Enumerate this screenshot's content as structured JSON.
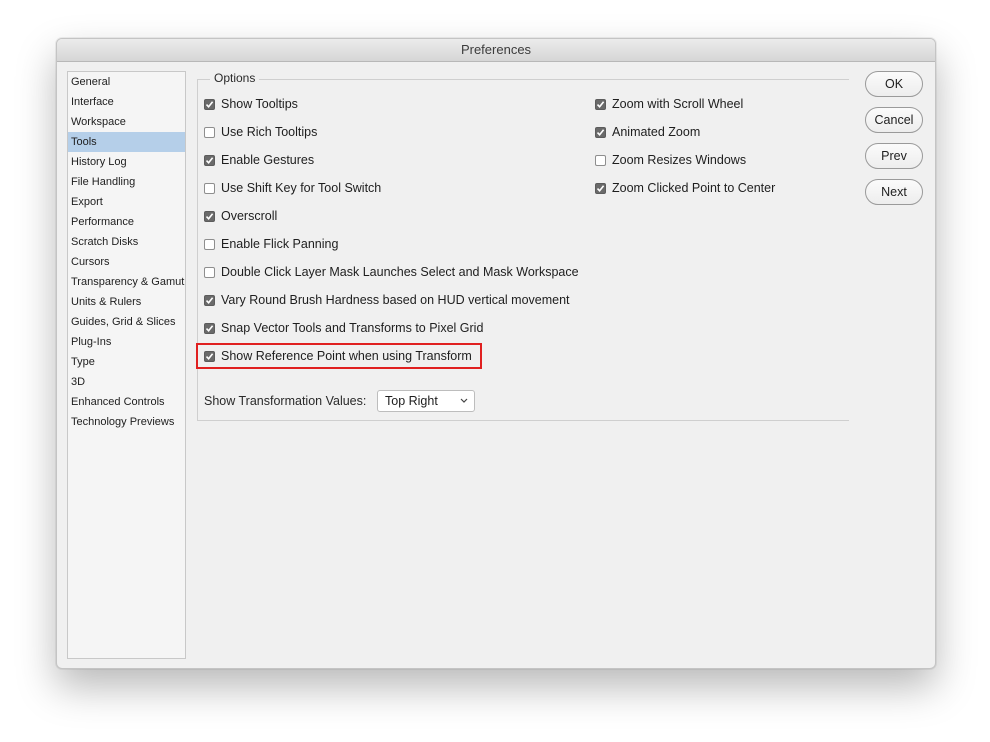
{
  "window": {
    "title": "Preferences"
  },
  "sidebar": {
    "items": [
      {
        "label": "General",
        "selected": false
      },
      {
        "label": "Interface",
        "selected": false
      },
      {
        "label": "Workspace",
        "selected": false
      },
      {
        "label": "Tools",
        "selected": true
      },
      {
        "label": "History Log",
        "selected": false
      },
      {
        "label": "File Handling",
        "selected": false
      },
      {
        "label": "Export",
        "selected": false
      },
      {
        "label": "Performance",
        "selected": false
      },
      {
        "label": "Scratch Disks",
        "selected": false
      },
      {
        "label": "Cursors",
        "selected": false
      },
      {
        "label": "Transparency & Gamut",
        "selected": false
      },
      {
        "label": "Units & Rulers",
        "selected": false
      },
      {
        "label": "Guides, Grid & Slices",
        "selected": false
      },
      {
        "label": "Plug-Ins",
        "selected": false
      },
      {
        "label": "Type",
        "selected": false
      },
      {
        "label": "3D",
        "selected": false
      },
      {
        "label": "Enhanced Controls",
        "selected": false
      },
      {
        "label": "Technology Previews",
        "selected": false
      }
    ]
  },
  "options": {
    "legend": "Options",
    "left_column": [
      {
        "label": "Show Tooltips",
        "checked": true
      },
      {
        "label": "Use Rich Tooltips",
        "checked": false
      },
      {
        "label": "Enable Gestures",
        "checked": true
      },
      {
        "label": "Use Shift Key for Tool Switch",
        "checked": false
      },
      {
        "label": "Overscroll",
        "checked": true
      },
      {
        "label": "Enable Flick Panning",
        "checked": false
      },
      {
        "label": "Double Click Layer Mask Launches Select and Mask Workspace",
        "checked": false
      },
      {
        "label": "Vary Round Brush Hardness based on HUD vertical movement",
        "checked": true
      },
      {
        "label": "Snap Vector Tools and Transforms to Pixel Grid",
        "checked": true
      },
      {
        "label": "Show Reference Point when using Transform",
        "checked": true
      }
    ],
    "right_column": [
      {
        "label": "Zoom with Scroll Wheel",
        "checked": true
      },
      {
        "label": "Animated Zoom",
        "checked": true
      },
      {
        "label": "Zoom Resizes Windows",
        "checked": false
      },
      {
        "label": "Zoom Clicked Point to Center",
        "checked": true
      }
    ],
    "transformation_values": {
      "label": "Show Transformation Values:",
      "selected": "Top Right"
    }
  },
  "buttons": {
    "ok": "OK",
    "cancel": "Cancel",
    "prev": "Prev",
    "next": "Next"
  },
  "colors": {
    "selected_item_bg": "#b5cfe9",
    "highlight_border": "#e02020",
    "checkbox_checked": "#6a6a6a"
  }
}
